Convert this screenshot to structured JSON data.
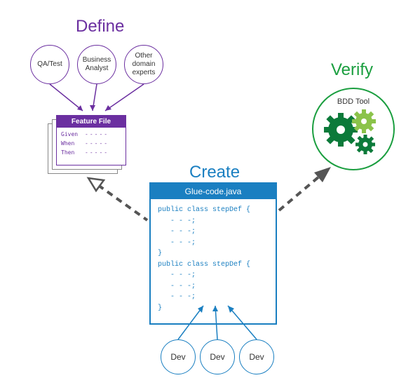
{
  "stages": {
    "define": "Define",
    "create": "Create",
    "verify": "Verify"
  },
  "define_roles": [
    {
      "label": "QA/Test"
    },
    {
      "label": "Business Analyst"
    },
    {
      "label": "Other domain experts"
    }
  ],
  "feature_file": {
    "title": "Feature File",
    "keywords": [
      "Given",
      "When",
      "Then"
    ]
  },
  "glue_code": {
    "filename": "Glue-code.java",
    "body": "public class stepDef {\n   - - -;\n   - - -;\n   - - -;\n}\npublic class stepDef {\n   - - -;\n   - - -;\n   - - -;\n}"
  },
  "bdd_tool": {
    "label": "BDD Tool"
  },
  "dev_roles": [
    {
      "label": "Dev"
    },
    {
      "label": "Dev"
    },
    {
      "label": "Dev"
    }
  ]
}
